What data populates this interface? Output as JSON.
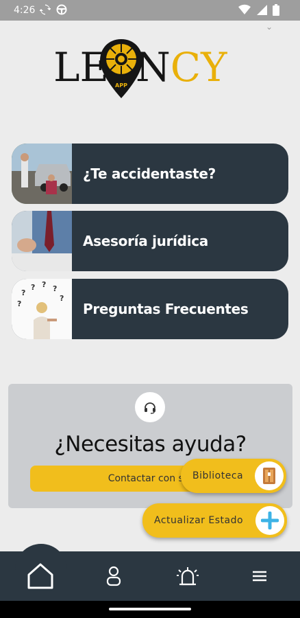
{
  "status_bar": {
    "time": "4:26"
  },
  "logo": {
    "left_text": "LE",
    "right_n": "N",
    "right_cy": "CY",
    "pin_text": "APP"
  },
  "menu": [
    {
      "label": "¿Te accidentaste?",
      "icon": "accident-photo"
    },
    {
      "label": "Asesoría jurídica",
      "icon": "legal-advice-photo"
    },
    {
      "label": "Preguntas Frecuentes",
      "icon": "faq-photo"
    }
  ],
  "help": {
    "icon": "headset-icon",
    "title": "¿Necesitas ayuda?",
    "contact_label": "Contactar con sop"
  },
  "fabs": {
    "library_label": "Biblioteca",
    "update_label": "Actualizar Estado"
  },
  "nav": [
    "home-icon",
    "profile-icon",
    "alarm-icon",
    "menu-icon"
  ],
  "colors": {
    "accent": "#f1be1c",
    "dark": "#2b3741",
    "background": "#ececec"
  }
}
